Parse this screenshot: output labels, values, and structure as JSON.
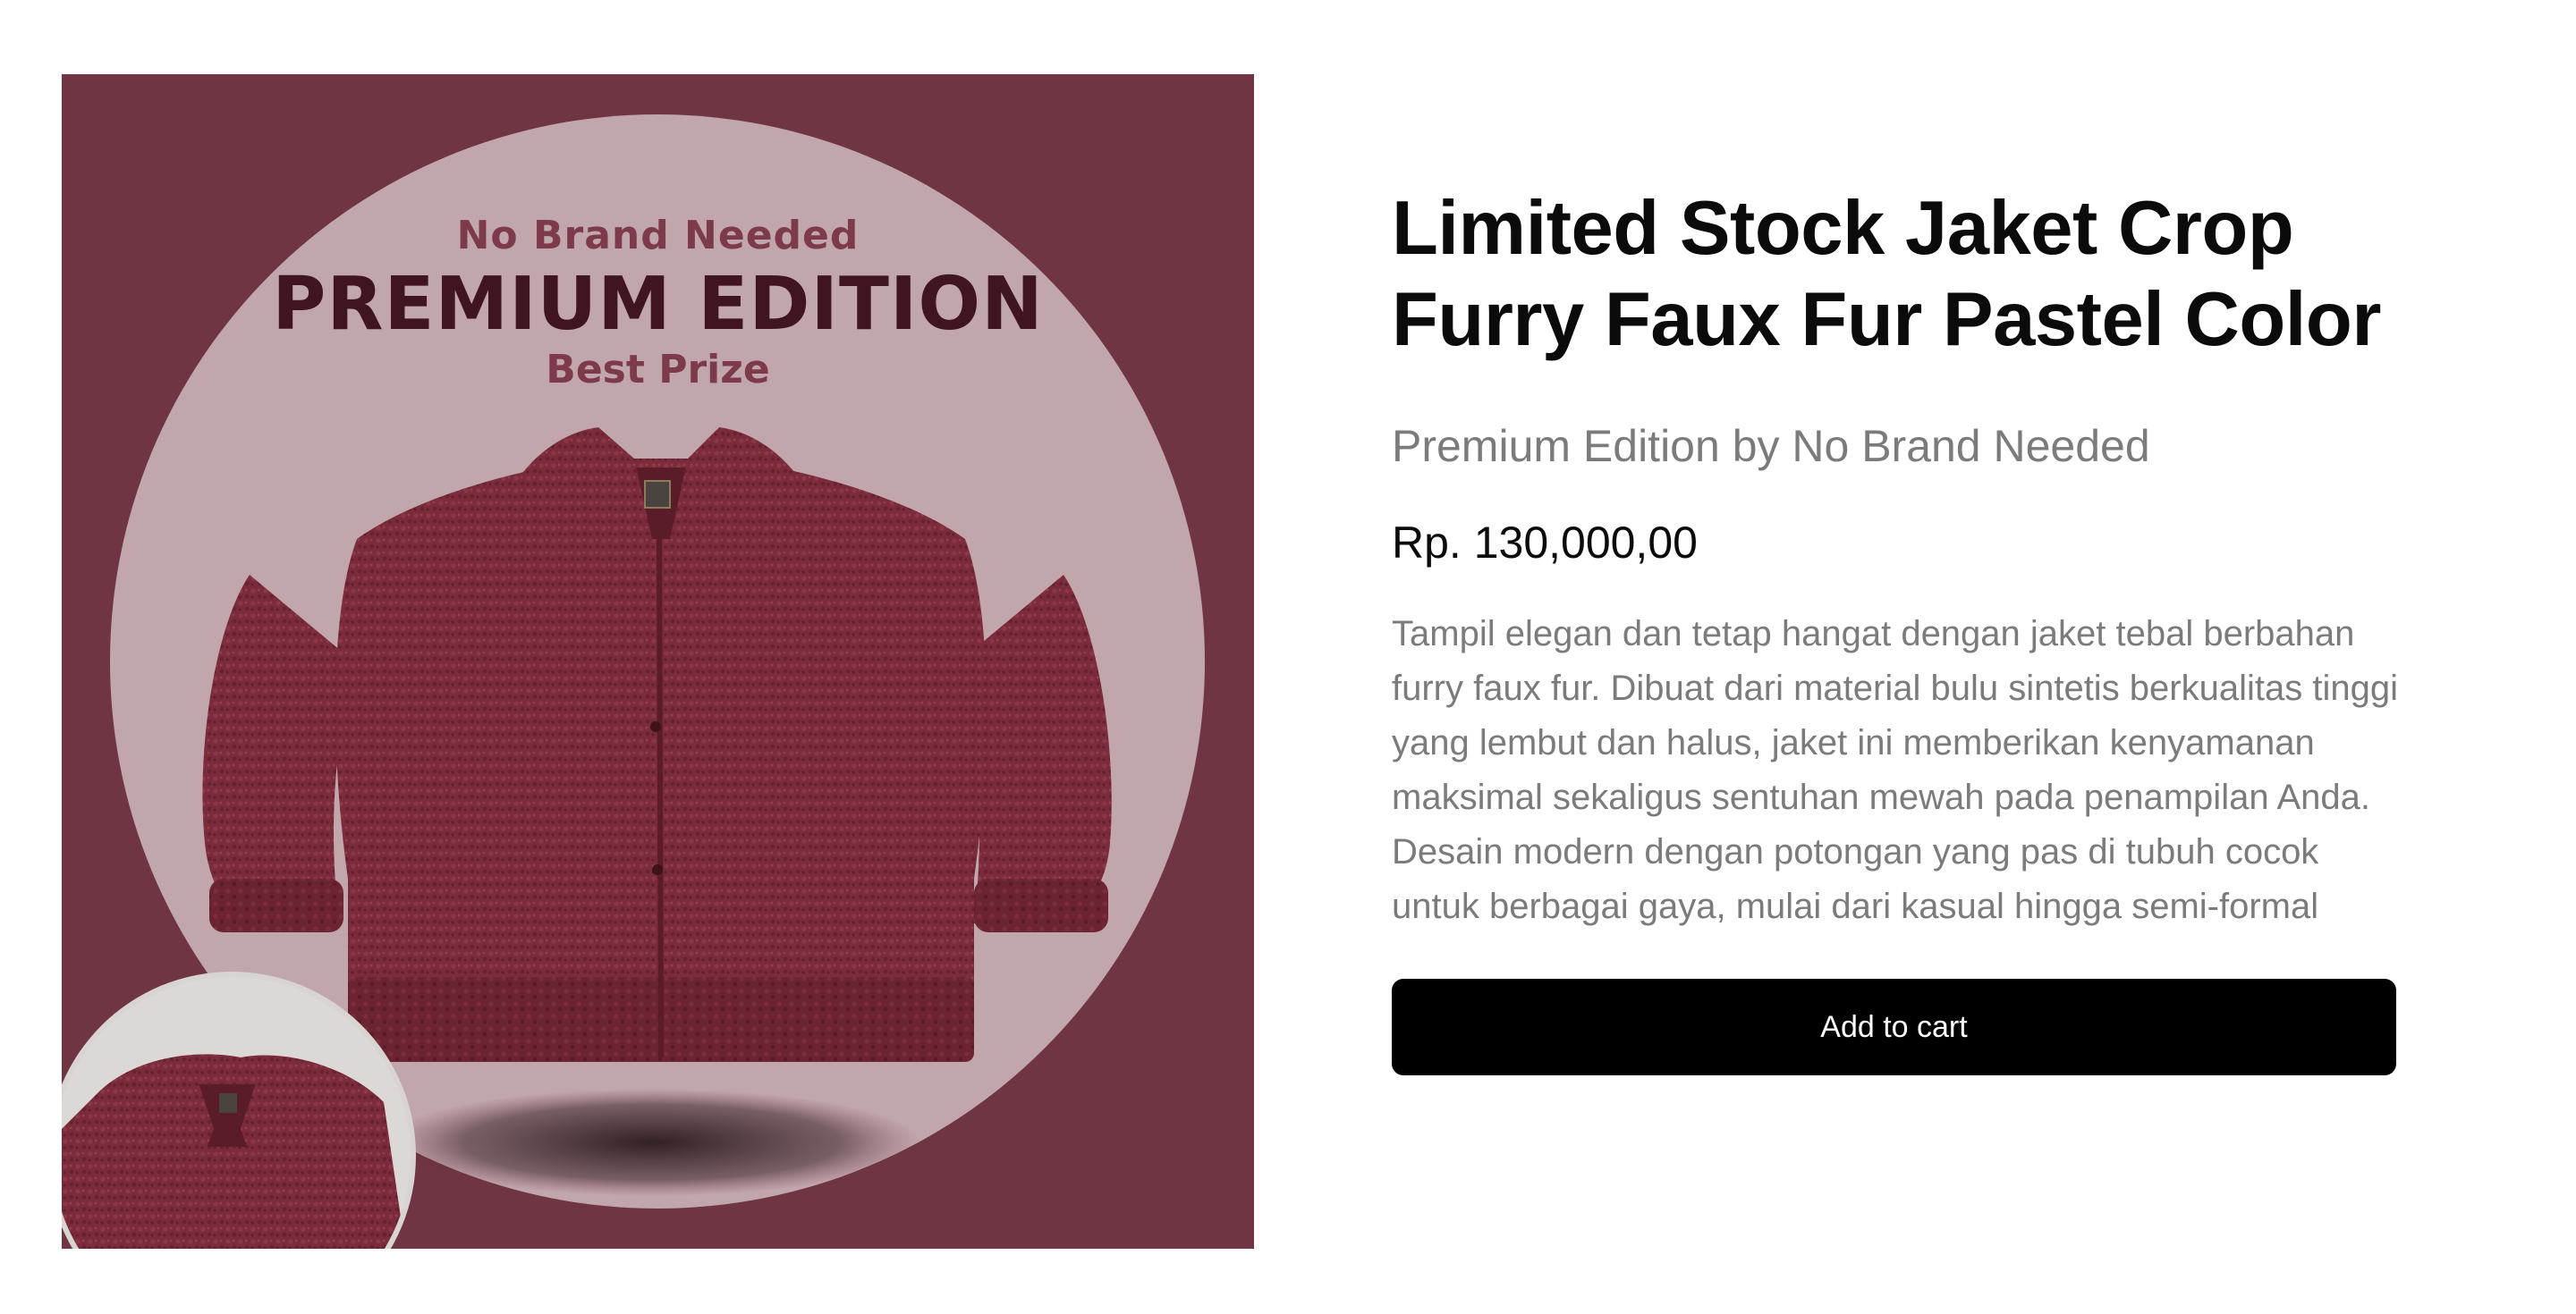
{
  "product": {
    "image": {
      "brand_text": "No Brand Needed",
      "edition_text": "PREMIUM EDITION",
      "tagline_text": "Best Prize",
      "background_color": "#703542",
      "circle_color": "#c1a6ab",
      "jacket_color": "#7a2b3c"
    },
    "title": "Limited Stock Jaket Crop Furry Faux Fur Pastel Color",
    "subtitle": "Premium Edition by No Brand Needed",
    "price": "Rp. 130,000,00",
    "description": "Tampil elegan dan tetap hangat dengan jaket tebal berbahan furry faux fur. Dibuat dari material bulu sintetis berkualitas tinggi yang lembut dan halus, jaket ini memberikan kenyamanan maksimal sekaligus sentuhan mewah pada penampilan Anda. Desain modern dengan potongan yang pas di tubuh cocok untuk berbagai gaya, mulai dari kasual hingga semi-formal",
    "add_to_cart_label": "Add to cart"
  }
}
